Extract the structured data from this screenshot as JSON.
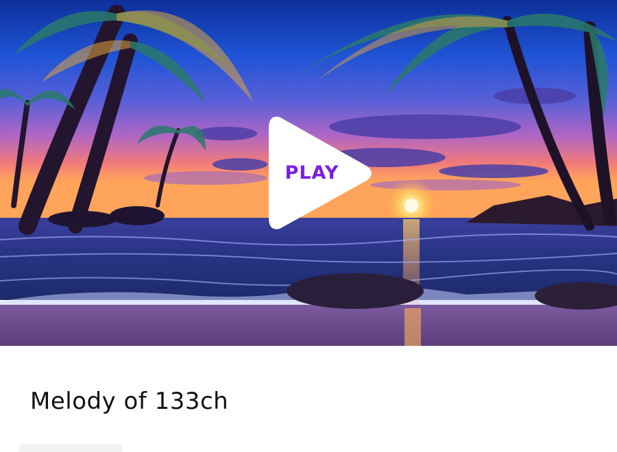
{
  "player": {
    "play_label": "PLAY",
    "title": "Melody of 133ch"
  },
  "colors": {
    "play_text": "#7a1ee6",
    "title_text": "#111111"
  },
  "icons": [
    "play-triangle-icon"
  ]
}
